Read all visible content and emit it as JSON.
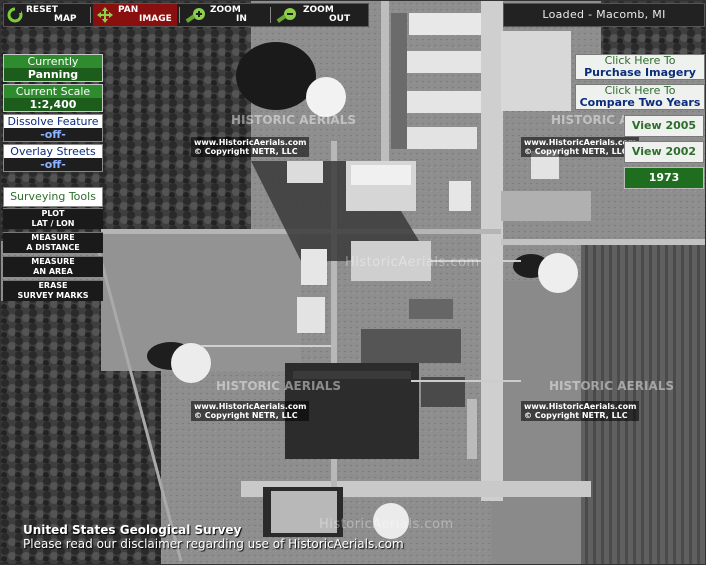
{
  "toolbar": {
    "reset": {
      "line1": "RESET",
      "line2": "MAP",
      "icon": "reset-icon"
    },
    "pan": {
      "line1": "PAN",
      "line2": "IMAGE",
      "icon": "pan-icon"
    },
    "zoom_in": {
      "line1": "ZOOM",
      "line2": "IN",
      "icon": "zoom-in-icon"
    },
    "zoom_out": {
      "line1": "ZOOM",
      "line2": "OUT",
      "icon": "zoom-out-icon"
    }
  },
  "loaded_status": "Loaded - Macomb, MI",
  "left_panel": {
    "currently": {
      "label": "Currently",
      "value": "Panning"
    },
    "scale": {
      "label": "Current Scale",
      "value": "1:2,400"
    },
    "dissolve": {
      "label": "Dissolve Feature",
      "value": "-off-"
    },
    "overlay": {
      "label": "Overlay Streets",
      "value": "-off-"
    },
    "surveying_title": "Surveying Tools",
    "tools": [
      {
        "line1": "PLOT",
        "line2": "LAT / LON"
      },
      {
        "line1": "MEASURE",
        "line2": "A DISTANCE"
      },
      {
        "line1": "MEASURE",
        "line2": "AN AREA"
      },
      {
        "line1": "ERASE",
        "line2": "SURVEY MARKS"
      }
    ]
  },
  "right_panel": {
    "purchase": {
      "line1": "Click Here To",
      "line2": "Purchase Imagery"
    },
    "compare": {
      "line1": "Click Here To",
      "line2": "Compare Two Years"
    },
    "years": [
      "View 2005",
      "View 2002",
      "1973"
    ],
    "current_year": "1973"
  },
  "watermark": {
    "brand": "HISTORIC AERIALS",
    "url_text": "HistoricAerials.com",
    "copy1": "www.HistoricAerials.com",
    "copy2": "© Copyright NETR, LLC"
  },
  "credit": {
    "line1": "United States Geological Survey",
    "line2": "Please read our disclaimer regarding use of HistoricAerials.com"
  },
  "colors": {
    "accent_green": "#2e8b2e",
    "dark_green": "#1c5d1c",
    "link_blue": "#0a2c7a",
    "active_red": "#8a1010"
  }
}
